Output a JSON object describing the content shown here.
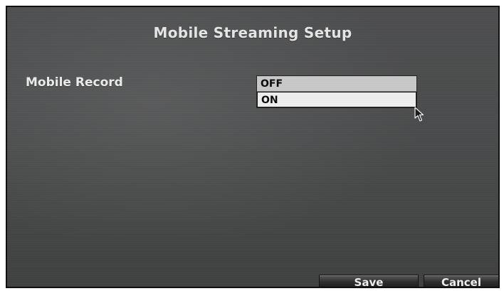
{
  "window": {
    "title": "Mobile Streaming Setup"
  },
  "form": {
    "mobile_record": {
      "label": "Mobile Record",
      "options": [
        "OFF",
        "ON"
      ],
      "selected": "ON"
    }
  },
  "buttons": {
    "save": "Save",
    "cancel": "Cancel"
  },
  "icons": {
    "cursor": "mouse-pointer-icon"
  },
  "colors": {
    "background": "#4b4c4d",
    "text": "#e6e6e6",
    "dropdown_bg": "#cfcfcf",
    "selected_option_bg": "#efefef"
  }
}
